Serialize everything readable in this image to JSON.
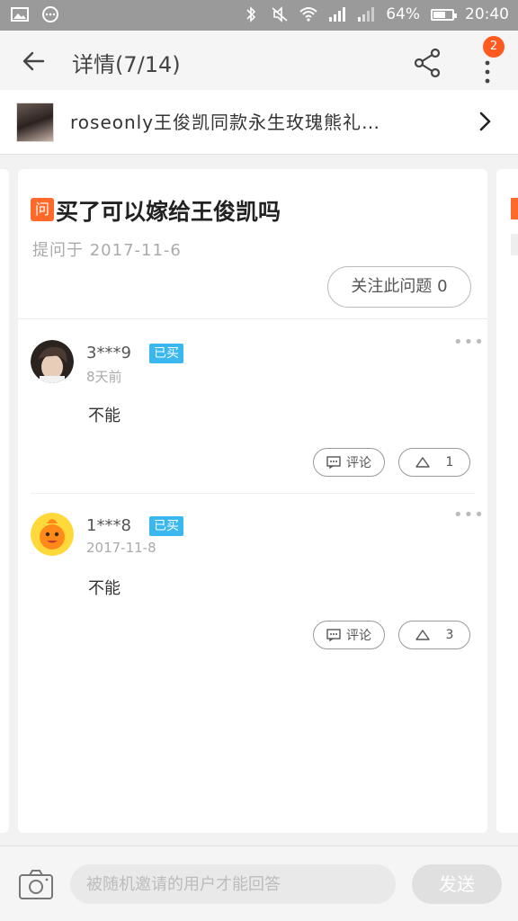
{
  "status_bar": {
    "battery_percent": "64%",
    "battery_level": 0.64,
    "time": "20:40",
    "icons": [
      "image-icon",
      "more-circle-icon",
      "bluetooth-icon",
      "mute-icon",
      "wifi-icon",
      "signal-icon",
      "signal-2-icon",
      "battery-icon"
    ]
  },
  "header": {
    "title": "详情(7/14)",
    "notification_count": "2"
  },
  "product": {
    "name": "roseonly王俊凯同款永生玫瑰熊礼…"
  },
  "question": {
    "tag": "问",
    "title": "买了可以嫁给王俊凯吗",
    "date": "提问于 2017-11-6",
    "follow_label": "关注此问题 0"
  },
  "answers": [
    {
      "user": "3***9",
      "bought_tag": "已买",
      "time": "8天前",
      "content": "不能",
      "comment_label": "评论",
      "like_count": "1"
    },
    {
      "user": "1***8",
      "bought_tag": "已买",
      "time": "2017-11-8",
      "content": "不能",
      "comment_label": "评论",
      "like_count": "3"
    }
  ],
  "bottom": {
    "placeholder": "被随机邀请的用户才能回答",
    "send_label": "发送"
  },
  "colors": {
    "accent": "#ff6a2a",
    "badge": "#ff5a1f",
    "bought": "#39b8f0"
  }
}
